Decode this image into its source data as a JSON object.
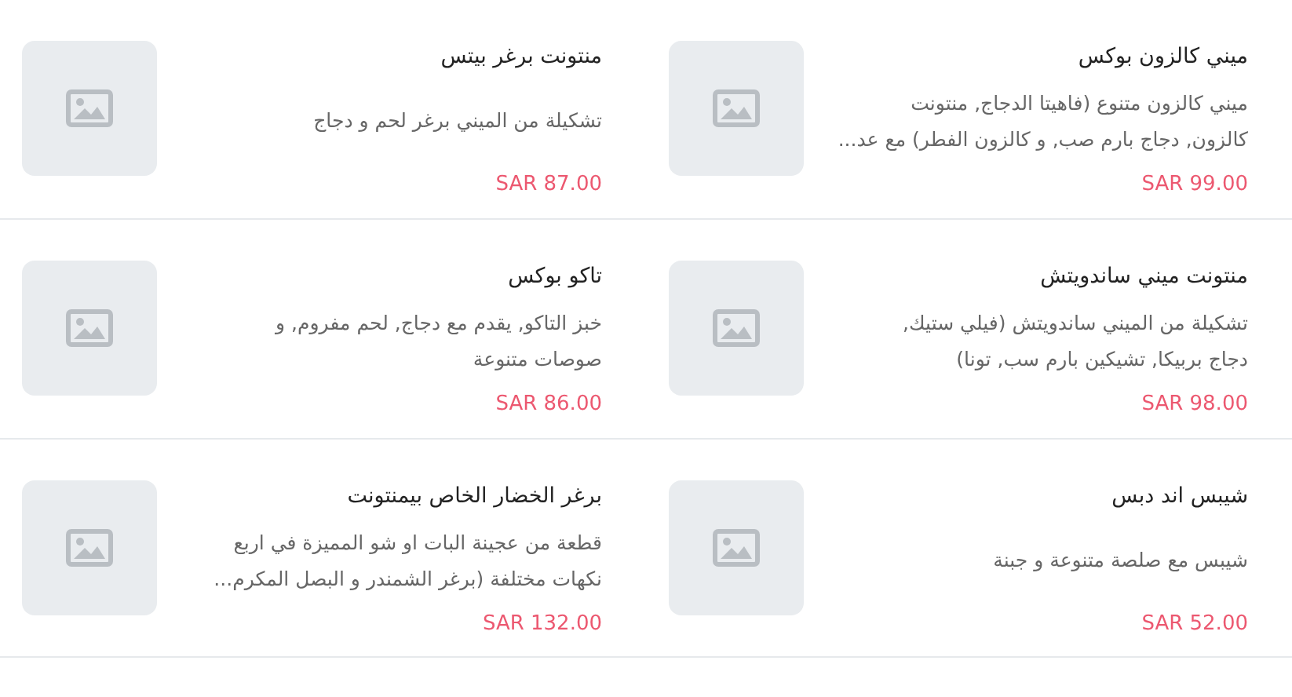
{
  "products": [
    {
      "title": "ميني كالزون بوكس",
      "description_lines": [
        "ميني كالزون متنوع (فاهيتا الدجاج, منتونت",
        "كالزون, دجاج بارم صب, و كالزون الفطر) مع عد..."
      ],
      "price": "SAR 99.00"
    },
    {
      "title": "منتونت برغر بيتس",
      "description_lines": [
        "تشكيلة من الميني برغر لحم و دجاج"
      ],
      "price": "SAR 87.00"
    },
    {
      "title": "منتونت ميني ساندويتش",
      "description_lines": [
        "تشكيلة من الميني ساندويتش (فيلي ستيك,",
        "دجاج بربيكا, تشيكين بارم سب, تونا)"
      ],
      "price": "SAR 98.00"
    },
    {
      "title": "تاكو بوكس",
      "description_lines": [
        "خبز التاكو, يقدم مع دجاج, لحم مفروم, و",
        "صوصات متنوعة"
      ],
      "price": "SAR 86.00"
    },
    {
      "title": "شيبس اند دبس",
      "description_lines": [
        "شيبس مع صلصة متنوعة و جبنة"
      ],
      "price": "SAR 52.00"
    },
    {
      "title": "برغر الخضار الخاص بيمنتونت",
      "description_lines": [
        "قطعة من عجينة البات او شو المميزة في اربع",
        "نكهات مختلفة (برغر الشمندر و البصل المكرم..."
      ],
      "price": "SAR 132.00"
    }
  ]
}
